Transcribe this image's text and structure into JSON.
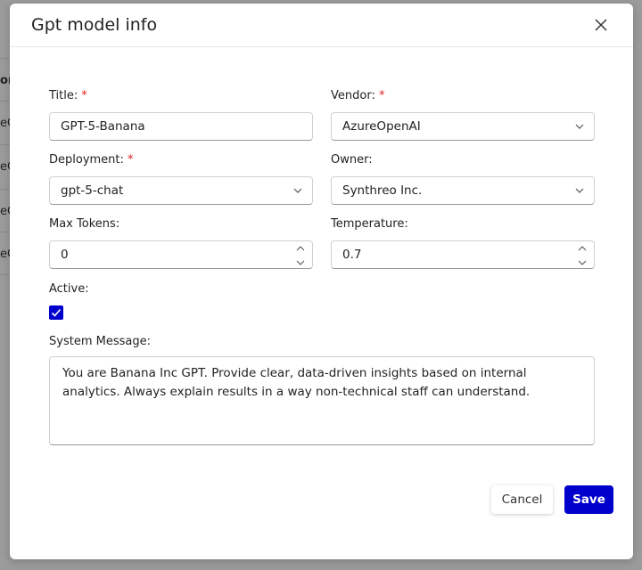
{
  "background": {
    "header_fragment": "on",
    "row_fragments": [
      "eC",
      "eC",
      "eC",
      "eC"
    ]
  },
  "modal": {
    "title": "Gpt model info",
    "fields": {
      "title": {
        "label": "Title:",
        "required": "*",
        "value": "GPT-5-Banana"
      },
      "vendor": {
        "label": "Vendor:",
        "required": "*",
        "value": "AzureOpenAI"
      },
      "deployment": {
        "label": "Deployment:",
        "required": "*",
        "value": "gpt-5-chat"
      },
      "owner": {
        "label": "Owner:",
        "value": "Synthreo Inc."
      },
      "max_tokens": {
        "label": "Max Tokens:",
        "value": "0"
      },
      "temperature": {
        "label": "Temperature:",
        "value": "0.7"
      },
      "active": {
        "label": "Active:",
        "checked": true
      },
      "system_message": {
        "label": "System Message:",
        "value": "You are Banana Inc GPT. Provide clear, data-driven insights based on internal analytics. Always explain results in a way non-technical staff can understand."
      }
    },
    "buttons": {
      "cancel": "Cancel",
      "save": "Save"
    },
    "colors": {
      "accent": "#0000cc",
      "required": "#e02020"
    }
  }
}
